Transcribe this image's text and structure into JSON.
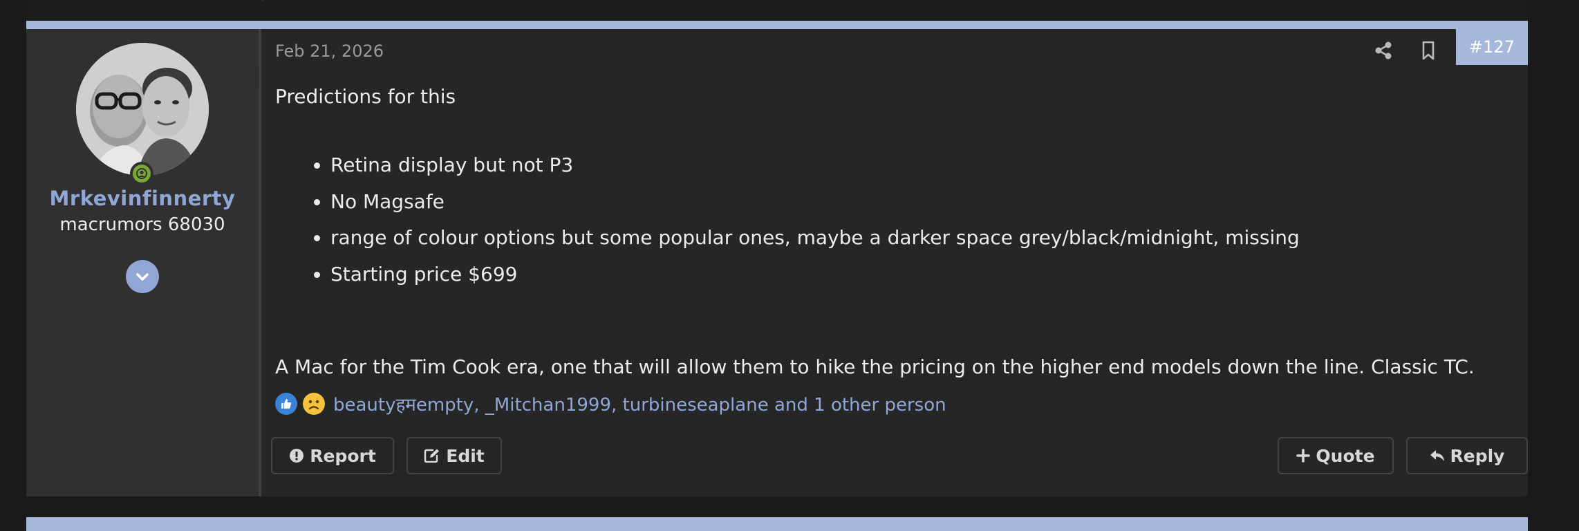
{
  "post": {
    "date": "Feb 21, 2026",
    "number": "#127",
    "intro": "Predictions for this",
    "bullets": [
      "Retina display but not P3",
      "No Magsafe",
      "range of colour options but some popular ones, maybe a darker space grey/black/midnight, missing",
      "Starting price $699"
    ],
    "closing": "A Mac for the Tim Cook era, one that will allow them to hike the pricing on the higher end models down the line. Classic TC."
  },
  "user": {
    "name": "Mrkevinfinnerty",
    "title": "macrumors 68030"
  },
  "reactions": {
    "icons": [
      "thumbs-up-icon",
      "sad-face-icon"
    ],
    "users_text": "beautyहमempty, _Mitchan1999, turbineseaplane and 1 other person"
  },
  "actions": {
    "report": "Report",
    "edit": "Edit",
    "quote": "Quote",
    "reply": "Reply"
  },
  "colors": {
    "accent": "#a7b8dd",
    "username": "#8fa6d6",
    "background": "#262626",
    "sidebar": "#303030",
    "online": "#7aa835"
  }
}
